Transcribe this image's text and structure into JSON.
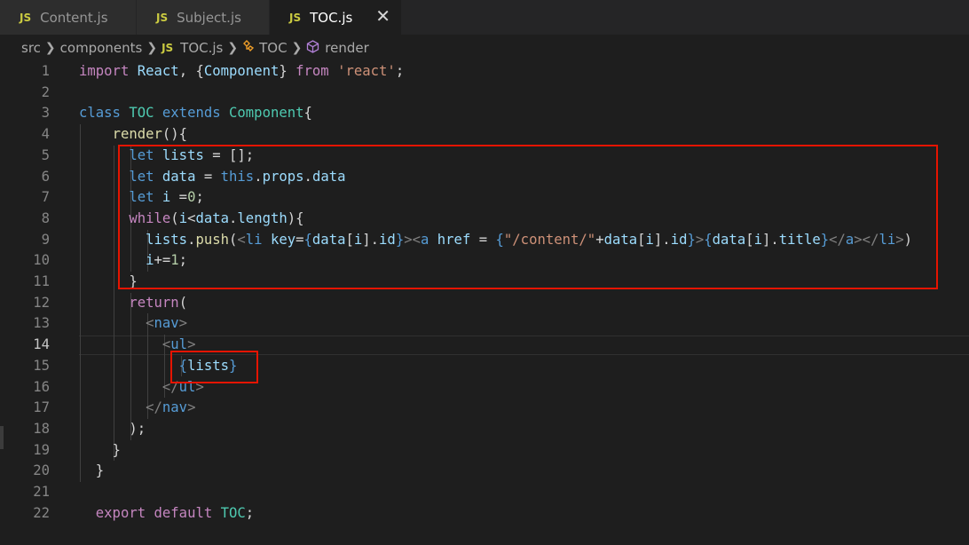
{
  "tabs": [
    {
      "badge": "JS",
      "label": "Content.js"
    },
    {
      "badge": "JS",
      "label": "Subject.js"
    },
    {
      "badge": "JS",
      "label": "TOC.js",
      "close": "✕"
    }
  ],
  "breadcrumb": {
    "folder1": "src",
    "folder2": "components",
    "file_badge": "JS",
    "file": "TOC.js",
    "class_name": "TOC",
    "method": "render"
  },
  "editor": {
    "active_line": 14,
    "line_numbers": [
      "1",
      "2",
      "3",
      "4",
      "5",
      "6",
      "7",
      "8",
      "9",
      "10",
      "11",
      "12",
      "13",
      "14",
      "15",
      "16",
      "17",
      "18",
      "19",
      "20",
      "21",
      "22"
    ],
    "lines": [
      [
        [
          "c",
          "import"
        ],
        [
          "p",
          " "
        ],
        [
          "v",
          "React"
        ],
        [
          "p",
          ", {"
        ],
        [
          "v",
          "Component"
        ],
        [
          "p",
          "} "
        ],
        [
          "c",
          "from"
        ],
        [
          "p",
          " "
        ],
        [
          "s",
          "'react'"
        ],
        [
          "p",
          ";"
        ]
      ],
      [],
      [
        [
          "k",
          "class"
        ],
        [
          "p",
          " "
        ],
        [
          "t",
          "TOC"
        ],
        [
          "p",
          " "
        ],
        [
          "k",
          "extends"
        ],
        [
          "p",
          " "
        ],
        [
          "t",
          "Component"
        ],
        [
          "p",
          "{"
        ]
      ],
      [
        [
          "p",
          "    "
        ],
        [
          "f",
          "render"
        ],
        [
          "p",
          "(){"
        ]
      ],
      [
        [
          "p",
          "      "
        ],
        [
          "k",
          "let"
        ],
        [
          "p",
          " "
        ],
        [
          "v",
          "lists"
        ],
        [
          "p",
          " = [];"
        ]
      ],
      [
        [
          "p",
          "      "
        ],
        [
          "k",
          "let"
        ],
        [
          "p",
          " "
        ],
        [
          "v",
          "data"
        ],
        [
          "p",
          " = "
        ],
        [
          "k",
          "this"
        ],
        [
          "p",
          "."
        ],
        [
          "v",
          "props"
        ],
        [
          "p",
          "."
        ],
        [
          "v",
          "data"
        ]
      ],
      [
        [
          "p",
          "      "
        ],
        [
          "k",
          "let"
        ],
        [
          "p",
          " "
        ],
        [
          "v",
          "i"
        ],
        [
          "p",
          " ="
        ],
        [
          "n",
          "0"
        ],
        [
          "p",
          ";"
        ]
      ],
      [
        [
          "p",
          "      "
        ],
        [
          "c",
          "while"
        ],
        [
          "p",
          "("
        ],
        [
          "v",
          "i"
        ],
        [
          "p",
          "<"
        ],
        [
          "v",
          "data"
        ],
        [
          "p",
          "."
        ],
        [
          "v",
          "length"
        ],
        [
          "p",
          "){"
        ]
      ],
      [
        [
          "p",
          "        "
        ],
        [
          "v",
          "lists"
        ],
        [
          "p",
          "."
        ],
        [
          "f",
          "push"
        ],
        [
          "p",
          "("
        ],
        [
          "g",
          "<"
        ],
        [
          "k",
          "li"
        ],
        [
          "p",
          " "
        ],
        [
          "v",
          "key"
        ],
        [
          "p",
          "="
        ],
        [
          "k",
          "{"
        ],
        [
          "v",
          "data"
        ],
        [
          "p",
          "["
        ],
        [
          "v",
          "i"
        ],
        [
          "p",
          "]."
        ],
        [
          "v",
          "id"
        ],
        [
          "k",
          "}"
        ],
        [
          "g",
          "><"
        ],
        [
          "k",
          "a"
        ],
        [
          "p",
          " "
        ],
        [
          "v",
          "href"
        ],
        [
          "p",
          " = "
        ],
        [
          "k",
          "{"
        ],
        [
          "s",
          "\"/content/\""
        ],
        [
          "p",
          "+"
        ],
        [
          "v",
          "data"
        ],
        [
          "p",
          "["
        ],
        [
          "v",
          "i"
        ],
        [
          "p",
          "]."
        ],
        [
          "v",
          "id"
        ],
        [
          "k",
          "}"
        ],
        [
          "g",
          ">"
        ],
        [
          "k",
          "{"
        ],
        [
          "v",
          "data"
        ],
        [
          "p",
          "["
        ],
        [
          "v",
          "i"
        ],
        [
          "p",
          "]."
        ],
        [
          "v",
          "title"
        ],
        [
          "k",
          "}"
        ],
        [
          "g",
          "</"
        ],
        [
          "k",
          "a"
        ],
        [
          "g",
          "></"
        ],
        [
          "k",
          "li"
        ],
        [
          "g",
          ">"
        ],
        [
          "p",
          ")"
        ]
      ],
      [
        [
          "p",
          "        "
        ],
        [
          "v",
          "i"
        ],
        [
          "p",
          "+="
        ],
        [
          "n",
          "1"
        ],
        [
          "p",
          ";"
        ]
      ],
      [
        [
          "p",
          "      }"
        ]
      ],
      [
        [
          "p",
          "      "
        ],
        [
          "c",
          "return"
        ],
        [
          "p",
          "("
        ]
      ],
      [
        [
          "p",
          "        "
        ],
        [
          "g",
          "<"
        ],
        [
          "k",
          "nav"
        ],
        [
          "g",
          ">"
        ]
      ],
      [
        [
          "p",
          "          "
        ],
        [
          "g",
          "<"
        ],
        [
          "k",
          "ul"
        ],
        [
          "g",
          ">"
        ]
      ],
      [
        [
          "p",
          "            "
        ],
        [
          "k",
          "{"
        ],
        [
          "v",
          "lists"
        ],
        [
          "k",
          "}"
        ]
      ],
      [
        [
          "p",
          "          "
        ],
        [
          "g",
          "</"
        ],
        [
          "k",
          "ul"
        ],
        [
          "g",
          ">"
        ]
      ],
      [
        [
          "p",
          "        "
        ],
        [
          "g",
          "</"
        ],
        [
          "k",
          "nav"
        ],
        [
          "g",
          ">"
        ]
      ],
      [
        [
          "p",
          "      );"
        ]
      ],
      [
        [
          "p",
          "    }"
        ]
      ],
      [
        [
          "p",
          "  }"
        ]
      ],
      [],
      [
        [
          "p",
          "  "
        ],
        [
          "c",
          "export"
        ],
        [
          "p",
          " "
        ],
        [
          "c",
          "default"
        ],
        [
          "p",
          " "
        ],
        [
          "t",
          "TOC"
        ],
        [
          "p",
          ";"
        ]
      ]
    ]
  }
}
